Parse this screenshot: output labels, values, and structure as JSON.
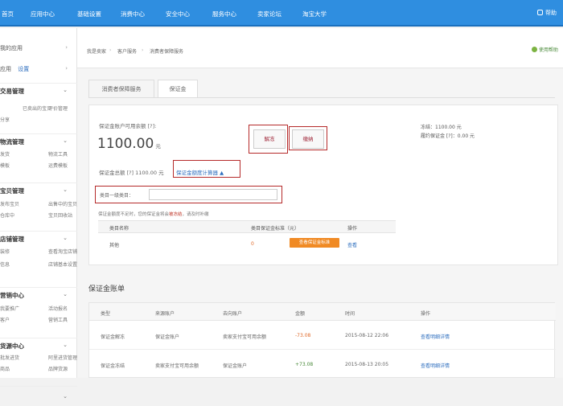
{
  "topnav": {
    "items": [
      "首页",
      "应用中心",
      "基础设置",
      "消费中心",
      "安全中心",
      "服务中心",
      "卖家论坛",
      "淘宝大学"
    ],
    "right": "帮助"
  },
  "sidebar": {
    "top_items": [
      {
        "label": "我的应用",
        "arrow": "›"
      },
      {
        "label": "应用",
        "extra": "设置",
        "arrow": "›"
      }
    ],
    "groups": [
      {
        "title": "交易管理",
        "chevron": "⌄",
        "subs": [
          "已卖出的宝贝",
          "评价管理",
          "分享"
        ]
      },
      {
        "title": "物流管理",
        "chevron": "⌄",
        "subs": [
          "发货",
          "物流工具",
          "模板",
          "运费模板"
        ]
      },
      {
        "title": "宝贝管理",
        "chevron": "⌄",
        "subs": [
          "发布宝贝",
          "出售中的宝贝",
          "仓库中",
          "宝贝回收站"
        ]
      },
      {
        "title": "店铺管理",
        "chevron": "⌄",
        "subs": [
          "装修",
          "查看淘宝店铺",
          "信息",
          "店铺基本设置"
        ]
      },
      {
        "title": "营销中心",
        "chevron": "⌄",
        "subs": [
          "我要推广",
          "活动报名",
          "客户",
          "营销工具"
        ]
      },
      {
        "title": "货源中心",
        "chevron": "⌄",
        "subs": [
          "批发进货",
          "阿里进货管理",
          "商品",
          "品牌货源"
        ]
      },
      {
        "title": "",
        "chevron": "⌄",
        "subs": []
      }
    ]
  },
  "breadcrumb": [
    "我是卖家",
    "客户服务",
    "消费者保障服务"
  ],
  "help_link": "使用帮助",
  "tabs": [
    "消费者保障服务",
    "保证金"
  ],
  "panel": {
    "available_label": "保证金账户可用余额",
    "available_hint": "[?]:",
    "available_amount": "1100.00",
    "unit": "元",
    "button_unfreeze": "解冻",
    "button_withdraw": "缴纳",
    "frozen_label": "冻结：1100.00 元",
    "contract_label": "履约保证金 [?]：0.00 元",
    "total_label": "保证金总额 [?] 1100.00 元",
    "calc_link": "保证金额度计算器",
    "calc_arrow": "▲",
    "field_label": "类目一级类目：",
    "note": "保证金额度不足时，您的保证金将会",
    "note_warn": "被冻结",
    "note_tail": "，请及时补缴",
    "table_head": [
      "类目名称",
      "类目保证金标准（元）",
      "操作"
    ],
    "table_row": [
      "其他",
      "0",
      "查看保证金标准",
      "查看"
    ]
  },
  "ledger": {
    "title": "保证金账单",
    "head": [
      "类型",
      "来源账户",
      "去向账户",
      "金额",
      "时间",
      "操作"
    ],
    "rows": [
      [
        "保证金解冻",
        "保证金账户",
        "卖家支付宝可用余额",
        "-73.08",
        "2015-08-12 22:06",
        "查看明细详情"
      ],
      [
        "保证金冻结",
        "卖家支付宝可用余额",
        "保证金账户",
        "+73.08",
        "2015-08-13 20:05",
        "查看明细详情"
      ]
    ]
  },
  "colors": {
    "nav": "#2f8ee0",
    "highlight": "#b52a2a",
    "orange": "#f08a24",
    "link": "#2f6fbf"
  }
}
